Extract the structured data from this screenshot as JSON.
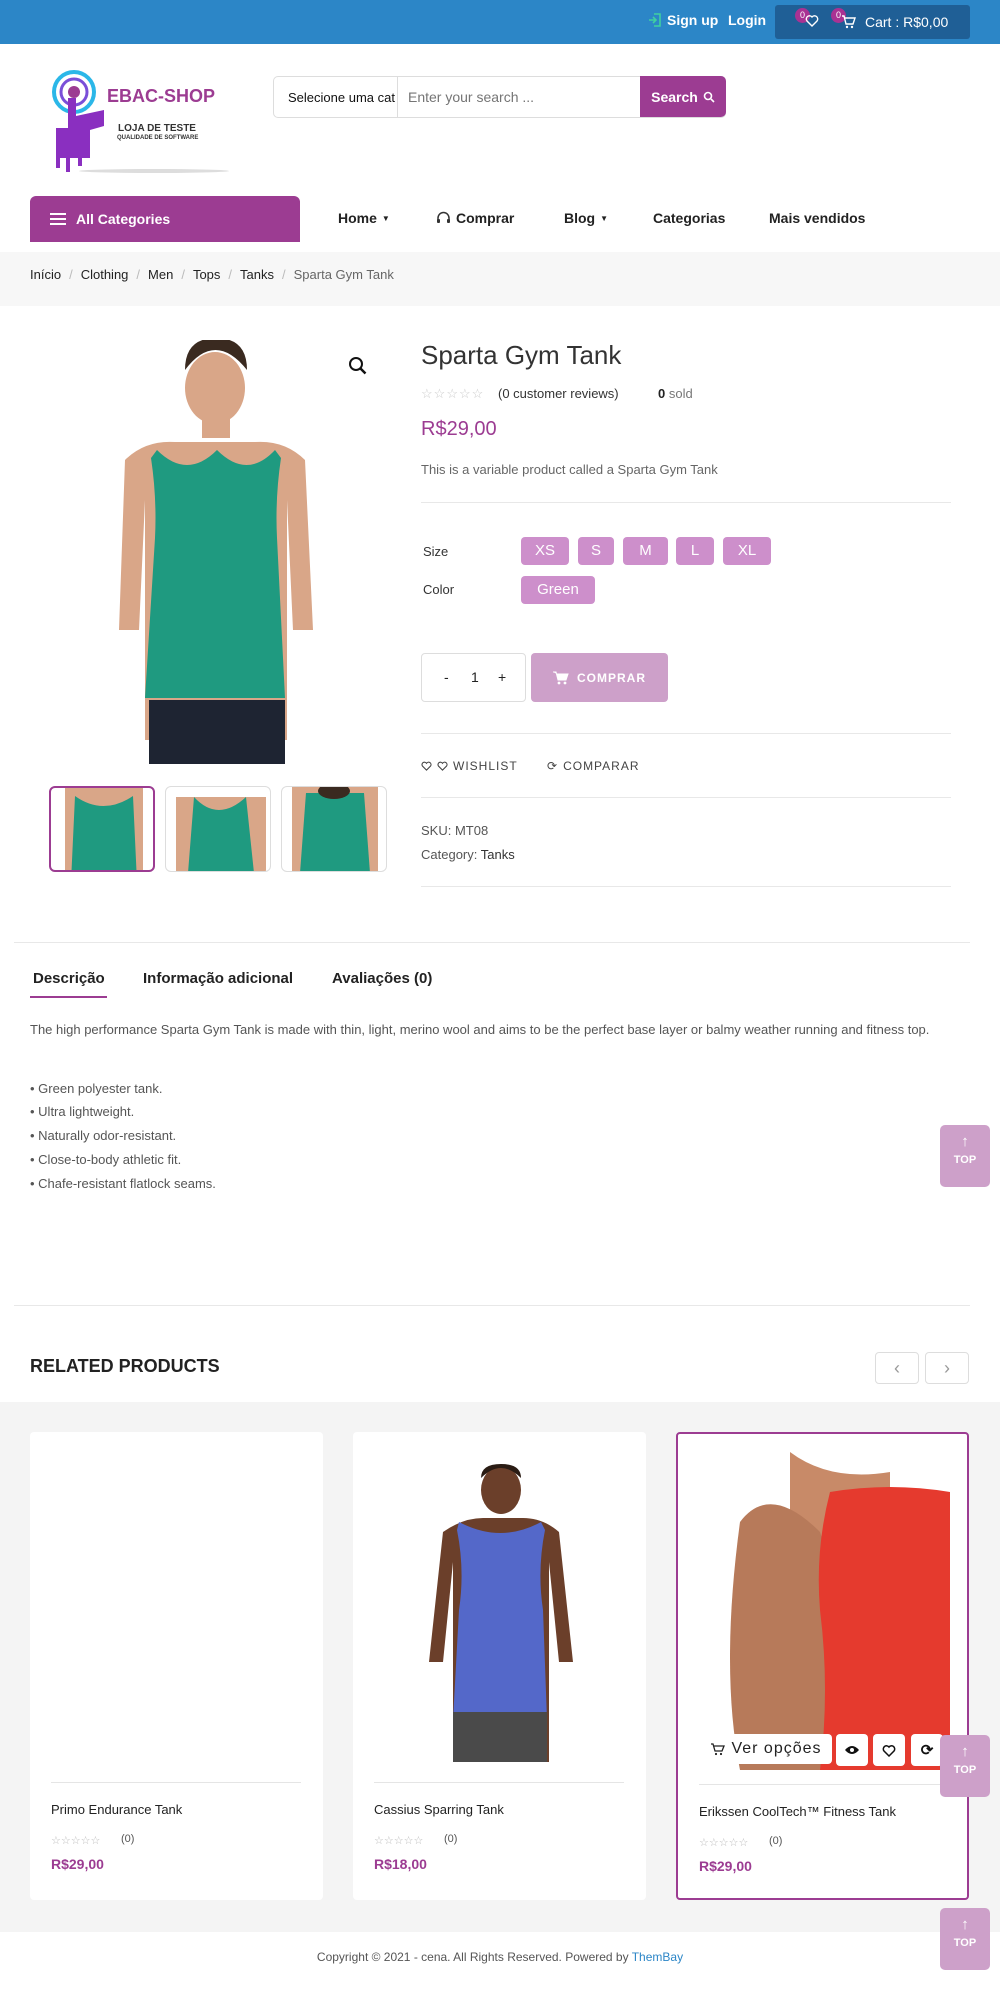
{
  "topbar": {
    "signup": "Sign up",
    "login": "Login",
    "wishlist_count": "0",
    "cart_count": "0",
    "cart_label": "Cart : R$0,00"
  },
  "logo": {
    "brand": "EBAC-SHOP",
    "line1": "LOJA DE TESTE",
    "line2": "QUALIDADE DE SOFTWARE"
  },
  "search": {
    "category": "Selecione uma cat",
    "placeholder": "Enter your search ...",
    "button": "Search"
  },
  "nav": {
    "all_categories": "All Categories",
    "home": "Home",
    "comprar": "Comprar",
    "blog": "Blog",
    "categorias": "Categorias",
    "mais_vendidos": "Mais vendidos"
  },
  "breadcrumb": [
    "Início",
    "Clothing",
    "Men",
    "Tops",
    "Tanks",
    "Sparta Gym Tank"
  ],
  "product": {
    "title": "Sparta Gym Tank",
    "reviews": "(0 customer reviews)",
    "sold_count": "0",
    "sold_label": "sold",
    "price": "R$29,00",
    "short_desc": "This is a variable product called a Sparta Gym Tank",
    "size_label": "Size",
    "sizes": [
      "XS",
      "S",
      "M",
      "L",
      "XL"
    ],
    "color_label": "Color",
    "color": "Green",
    "qty": "1",
    "qty_minus": "-",
    "qty_plus": "+",
    "buy": "COMPRAR",
    "wishlist": "WISHLIST",
    "compare": "COMPARAR",
    "sku_label": "SKU:",
    "sku": "MT08",
    "category_label": "Category:",
    "category": "Tanks",
    "colors": {
      "tank": "#1f9a80",
      "accent": "#9c3c92",
      "swatch": "#cd8fcb"
    }
  },
  "tabs": {
    "desc": "Descrição",
    "info": "Informação adicional",
    "reviews": "Avaliações (0)"
  },
  "description": {
    "para": "The high performance Sparta Gym Tank is made with thin, light, merino wool and aims to be the perfect base layer or balmy weather running and fitness top.",
    "bullets": [
      "• Green polyester tank.",
      "• Ultra lightweight.",
      "• Naturally odor-resistant.",
      "• Close-to-body athletic fit.",
      "• Chafe-resistant flatlock seams."
    ]
  },
  "top_label": "TOP",
  "related": {
    "title": "RELATED PRODUCTS",
    "prev": "‹",
    "next": "›",
    "products": [
      {
        "name": "Primo Endurance Tank",
        "count": "(0)",
        "price": "R$29,00"
      },
      {
        "name": "Cassius Sparring Tank",
        "count": "(0)",
        "price": "R$18,00"
      },
      {
        "name": "Erikssen CoolTech™ Fitness Tank",
        "count": "(0)",
        "price": "R$29,00"
      }
    ],
    "ver_opcoes": "Ver opções"
  },
  "footer": {
    "text": "Copyright © 2021 - cena. All Rights Reserved. Powered by ",
    "link": "ThemBay"
  }
}
